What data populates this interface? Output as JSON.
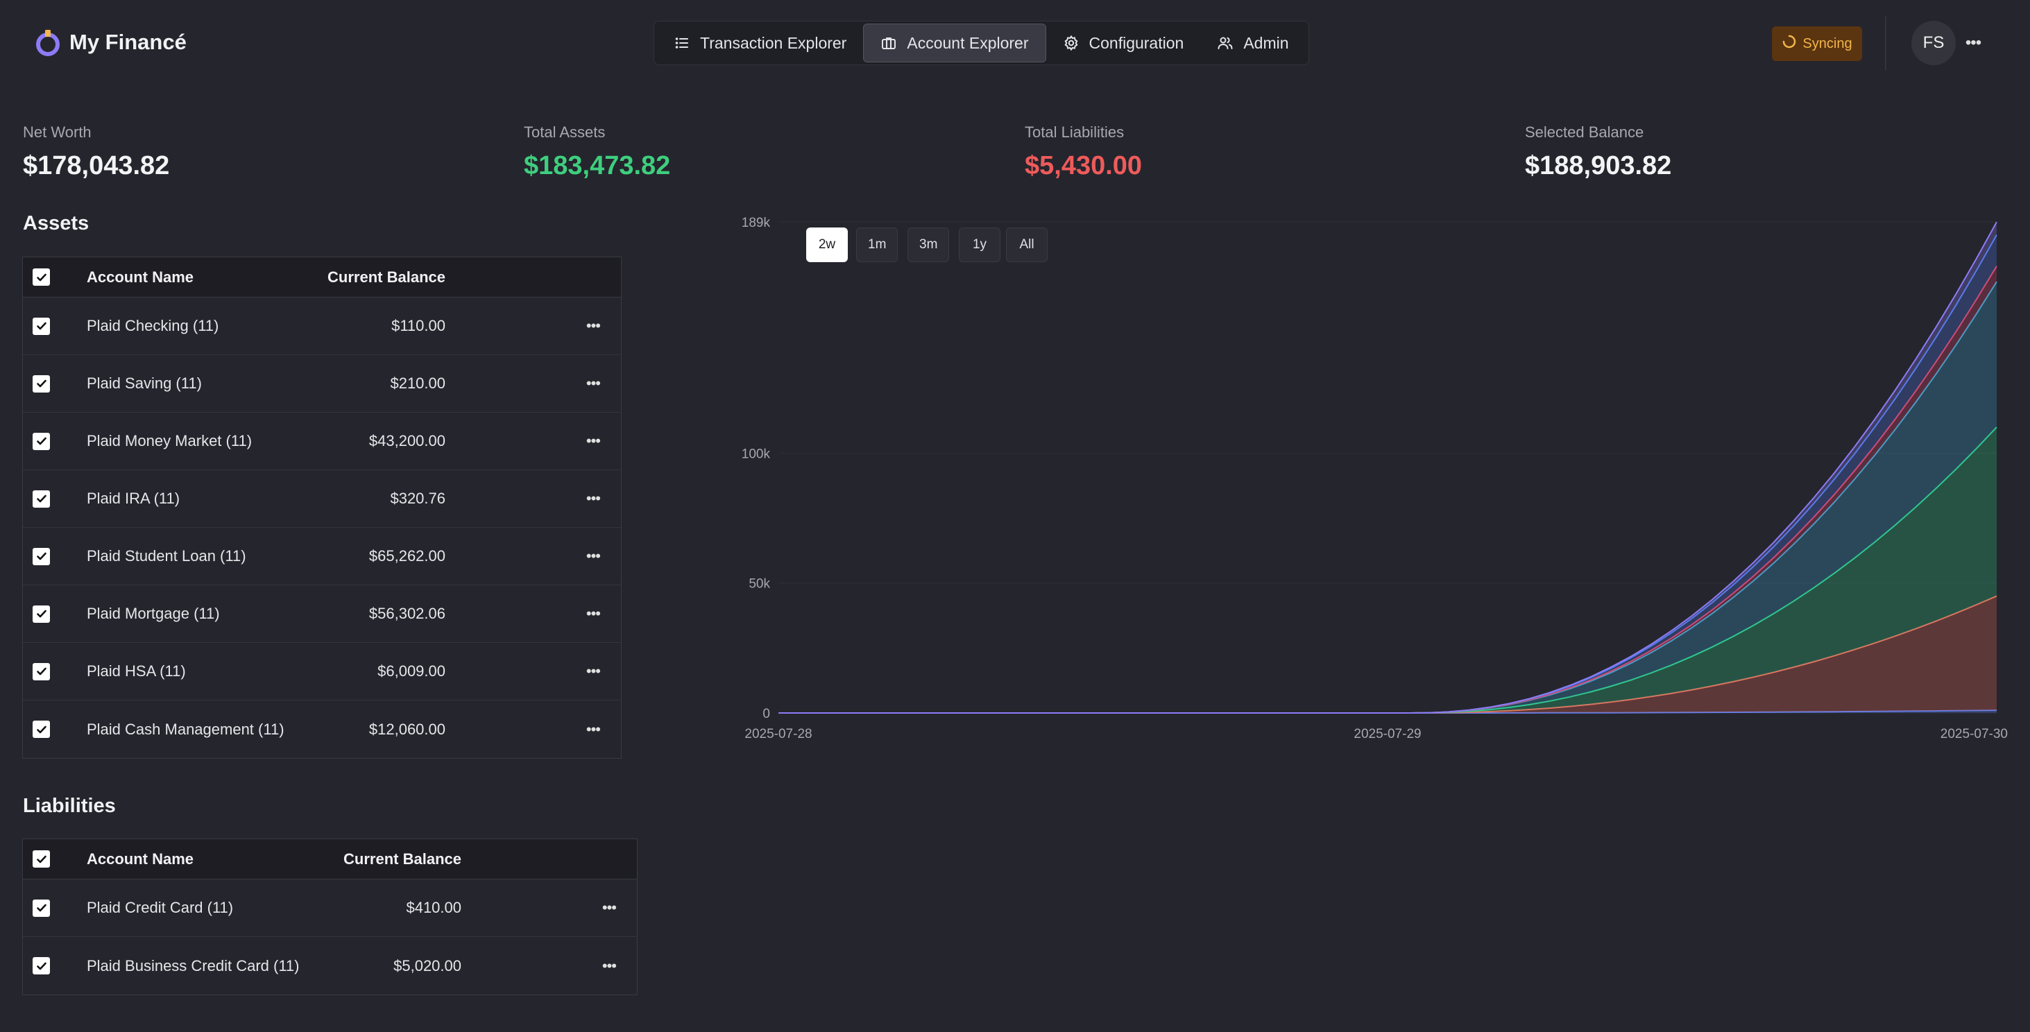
{
  "app": {
    "title": "My Financé"
  },
  "nav": {
    "tabs": [
      {
        "label": "Transaction Explorer",
        "icon": "list-icon"
      },
      {
        "label": "Account Explorer",
        "icon": "briefcase-icon",
        "active": true
      },
      {
        "label": "Configuration",
        "icon": "gear-icon"
      },
      {
        "label": "Admin",
        "icon": "users-icon"
      }
    ]
  },
  "status": {
    "sync_label": "Syncing",
    "color": "#f4b54b"
  },
  "user": {
    "initials": "FS"
  },
  "stats": {
    "net_worth": {
      "label": "Net Worth",
      "value": "$178,043.82"
    },
    "total_assets": {
      "label": "Total Assets",
      "value": "$183,473.82"
    },
    "total_liabilities": {
      "label": "Total Liabilities",
      "value": "$5,430.00"
    },
    "selected_balance": {
      "label": "Selected Balance",
      "value": "$188,903.82"
    }
  },
  "assets": {
    "title": "Assets",
    "headers": {
      "name": "Account Name",
      "balance": "Current Balance"
    },
    "rows": [
      {
        "name": "Plaid Checking (11)",
        "balance": "$110.00",
        "checked": true
      },
      {
        "name": "Plaid Saving (11)",
        "balance": "$210.00",
        "checked": true
      },
      {
        "name": "Plaid Money Market (11)",
        "balance": "$43,200.00",
        "checked": true
      },
      {
        "name": "Plaid IRA (11)",
        "balance": "$320.76",
        "checked": true
      },
      {
        "name": "Plaid Student Loan (11)",
        "balance": "$65,262.00",
        "checked": true
      },
      {
        "name": "Plaid Mortgage (11)",
        "balance": "$56,302.06",
        "checked": true
      },
      {
        "name": "Plaid HSA (11)",
        "balance": "$6,009.00",
        "checked": true
      },
      {
        "name": "Plaid Cash Management (11)",
        "balance": "$12,060.00",
        "checked": true
      }
    ]
  },
  "liabilities": {
    "title": "Liabilities",
    "headers": {
      "name": "Account Name",
      "balance": "Current Balance"
    },
    "rows": [
      {
        "name": "Plaid Credit Card (11)",
        "balance": "$410.00",
        "checked": true
      },
      {
        "name": "Plaid Business Credit Card (11)",
        "balance": "$5,020.00",
        "checked": true
      }
    ]
  },
  "range": {
    "options": [
      "2w",
      "1m",
      "3m",
      "1y",
      "All"
    ],
    "selected": "2w"
  },
  "colors": {
    "positive": "#3ecf7e",
    "negative": "#ef5b5b",
    "accent": "#8b7cf6"
  },
  "chart_data": {
    "type": "area",
    "stacked": true,
    "x": [
      "2025-07-28",
      "2025-07-29",
      "2025-07-30"
    ],
    "x_ticks": [
      "2025-07-28",
      "2025-07-29",
      "2025-07-30"
    ],
    "y_ticks": [
      "0",
      "50k",
      "100k",
      "189k"
    ],
    "ylim": [
      0,
      189000
    ],
    "grid": true,
    "legend": "none",
    "series": [
      {
        "values": [
          0,
          0,
          1000
        ],
        "color": "#5a7ff0"
      },
      {
        "values": [
          0,
          0,
          44000
        ],
        "color": "#ef6b5b"
      },
      {
        "values": [
          0,
          0,
          65000
        ],
        "color": "#2ecc86"
      },
      {
        "values": [
          0,
          0,
          56000
        ],
        "color": "#3aa6d0"
      },
      {
        "values": [
          0,
          0,
          6000
        ],
        "color": "#e0456a"
      },
      {
        "values": [
          0,
          0,
          12000
        ],
        "color": "#4f7be8"
      },
      {
        "values": [
          0,
          0,
          5000
        ],
        "color": "#8b7cf6"
      }
    ]
  }
}
